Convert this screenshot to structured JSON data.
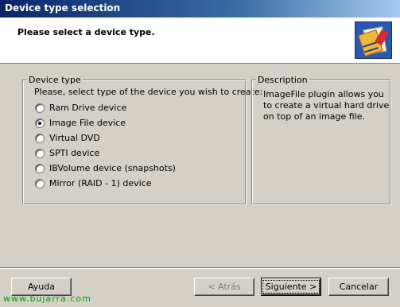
{
  "window": {
    "title": "Device type selection"
  },
  "header": {
    "text": "Please select a device type."
  },
  "device_type": {
    "legend": "Device type",
    "prompt": "Please, select type of the device you wish to create:",
    "options": [
      {
        "label": "Ram Drive device",
        "selected": false
      },
      {
        "label": "Image File device",
        "selected": true
      },
      {
        "label": "Virtual DVD",
        "selected": false
      },
      {
        "label": "SPTI device",
        "selected": false
      },
      {
        "label": "IBVolume device (snapshots)",
        "selected": false
      },
      {
        "label": "Mirror (RAID - 1) device",
        "selected": false
      }
    ]
  },
  "description": {
    "legend": "Description",
    "text": "ImageFile plugin allows you to create a virtual hard drive on top of an image file."
  },
  "buttons": {
    "help": "Ayuda",
    "back": "< Atrás",
    "next": "Siguiente >",
    "cancel": "Cancelar"
  },
  "watermark": "www.bujarra.com"
}
